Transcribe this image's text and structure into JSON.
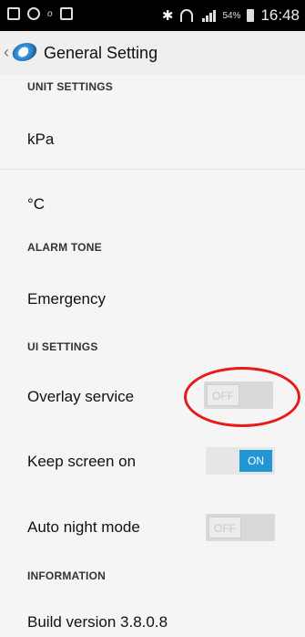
{
  "status_bar": {
    "battery_percent": "54%",
    "time": "16:48"
  },
  "app_bar": {
    "title": "General Setting"
  },
  "sections": {
    "unit_settings": "UNIT SETTINGS",
    "alarm_tone": "ALARM TONE",
    "ui_settings": "UI SETTINGS",
    "information": "INFORMATION"
  },
  "items": {
    "pressure_unit": "kPa",
    "temperature_unit": "°C",
    "alarm_tone_value": "Emergency",
    "overlay_service": "Overlay service",
    "keep_screen_on": "Keep screen on",
    "auto_night_mode": "Auto night mode",
    "build_version": "Build version  3.8.0.8"
  },
  "toggles": {
    "overlay_service": "OFF",
    "keep_screen_on": "ON",
    "auto_night_mode": "OFF"
  },
  "colors": {
    "toggle_on": "#2196d3",
    "highlight": "#e81a1a"
  }
}
